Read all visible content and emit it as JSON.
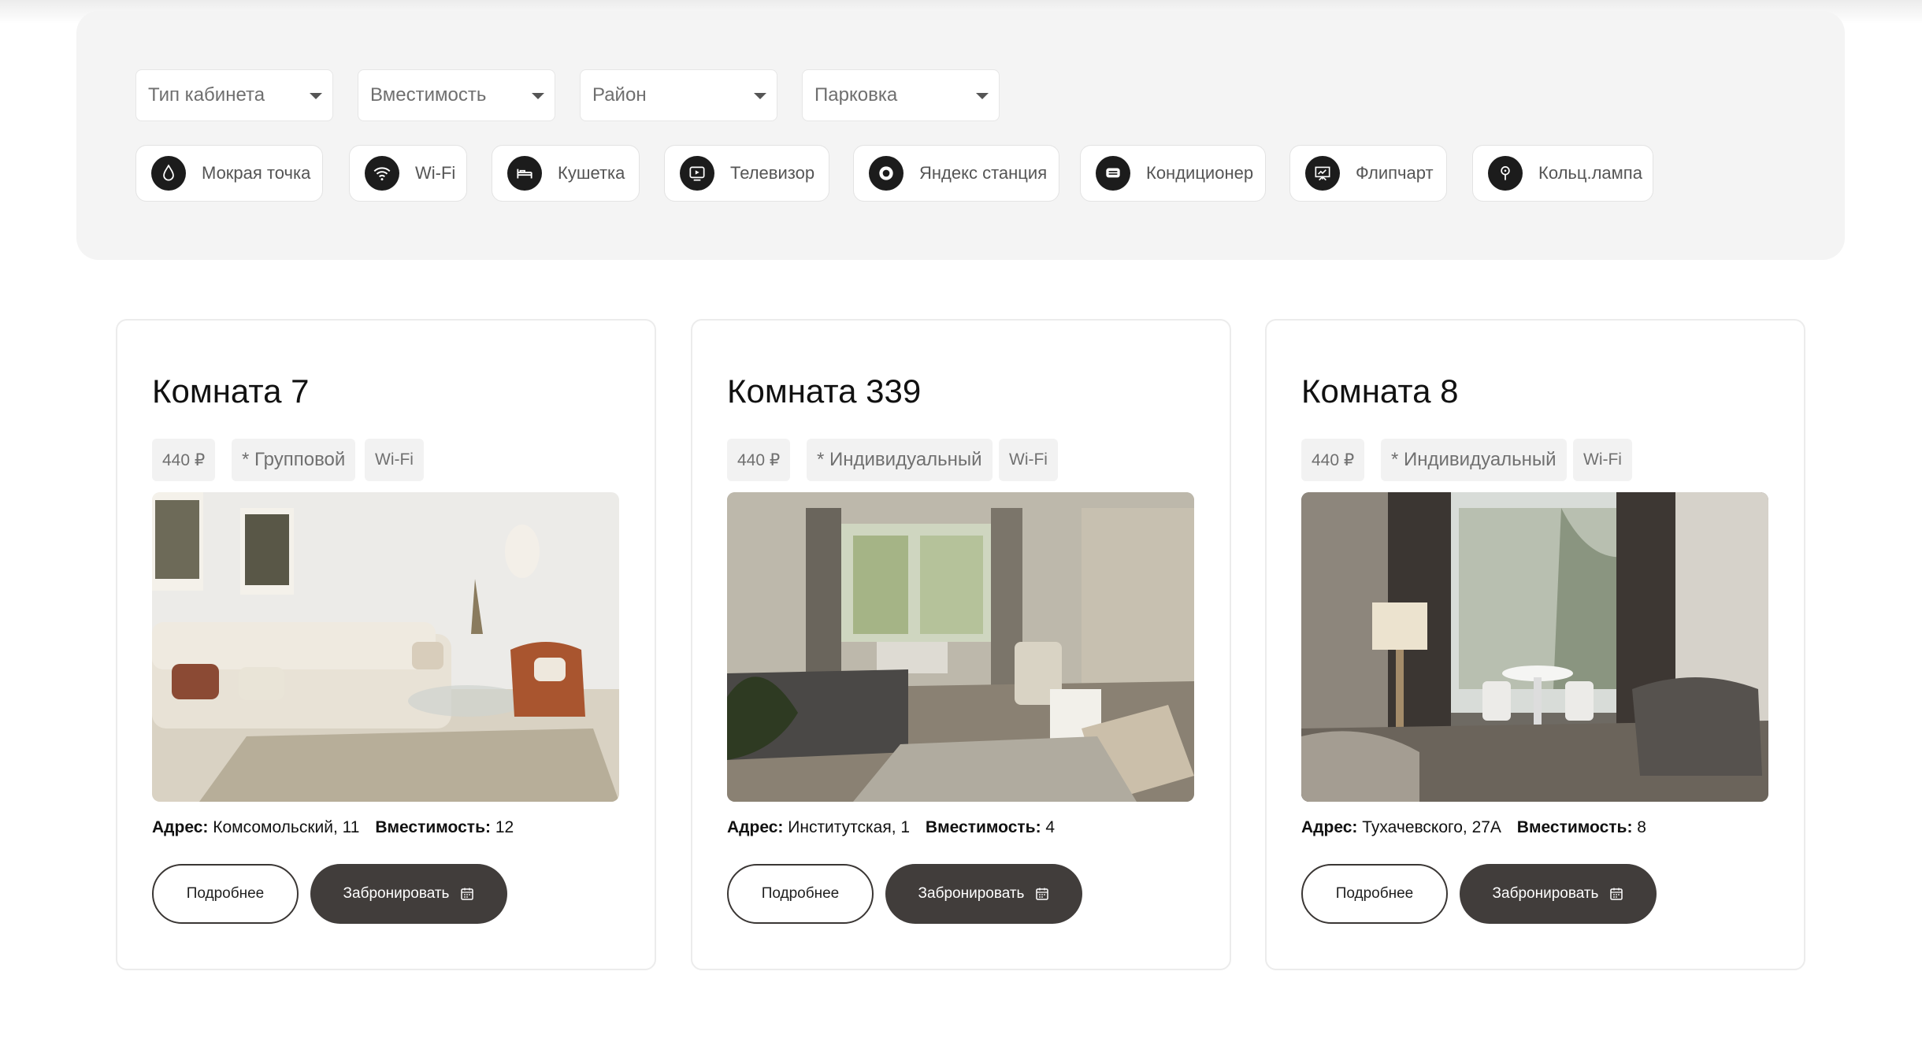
{
  "filters": {
    "selects": [
      {
        "label": "Тип кабинета"
      },
      {
        "label": "Вместимость"
      },
      {
        "label": "Район"
      },
      {
        "label": "Парковка"
      }
    ],
    "amenities": [
      {
        "label": "Мокрая точка",
        "icon": "water-drop-icon"
      },
      {
        "label": "Wi-Fi",
        "icon": "wifi-icon"
      },
      {
        "label": "Кушетка",
        "icon": "couch-icon"
      },
      {
        "label": "Телевизор",
        "icon": "tv-icon"
      },
      {
        "label": "Яндекс станция",
        "icon": "smart-speaker-icon"
      },
      {
        "label": "Кондиционер",
        "icon": "air-conditioner-icon"
      },
      {
        "label": "Флипчарт",
        "icon": "flipchart-icon"
      },
      {
        "label": "Кольц.лампа",
        "icon": "ring-lamp-icon"
      }
    ]
  },
  "rooms": [
    {
      "title": "Комната 7",
      "price": "440 ₽",
      "type": "* Групповой",
      "wifi": "Wi-Fi",
      "address_label": "Адрес:",
      "address": "Комсомольский, 11",
      "capacity_label": "Вместимость:",
      "capacity": "12",
      "photo": "room-7-photo"
    },
    {
      "title": "Комната 339",
      "price": "440 ₽",
      "type": "* Индивидуальный",
      "wifi": "Wi-Fi",
      "address_label": "Адрес:",
      "address": "Институтская, 1",
      "capacity_label": "Вместимость:",
      "capacity": "4",
      "photo": "room-339-photo"
    },
    {
      "title": "Комната 8",
      "price": "440 ₽",
      "type": "* Индивидуальный",
      "wifi": "Wi-Fi",
      "address_label": "Адрес:",
      "address": "Тухачевского, 27А",
      "capacity_label": "Вместимость:",
      "capacity": "8",
      "photo": "room-8-photo"
    }
  ],
  "buttons": {
    "more": "Подробнее",
    "book": "Забронировать"
  },
  "colors": {
    "panel_bg": "#f4f4f4",
    "icon_bg": "#1c1c1c",
    "book_button": "#413d3b"
  }
}
